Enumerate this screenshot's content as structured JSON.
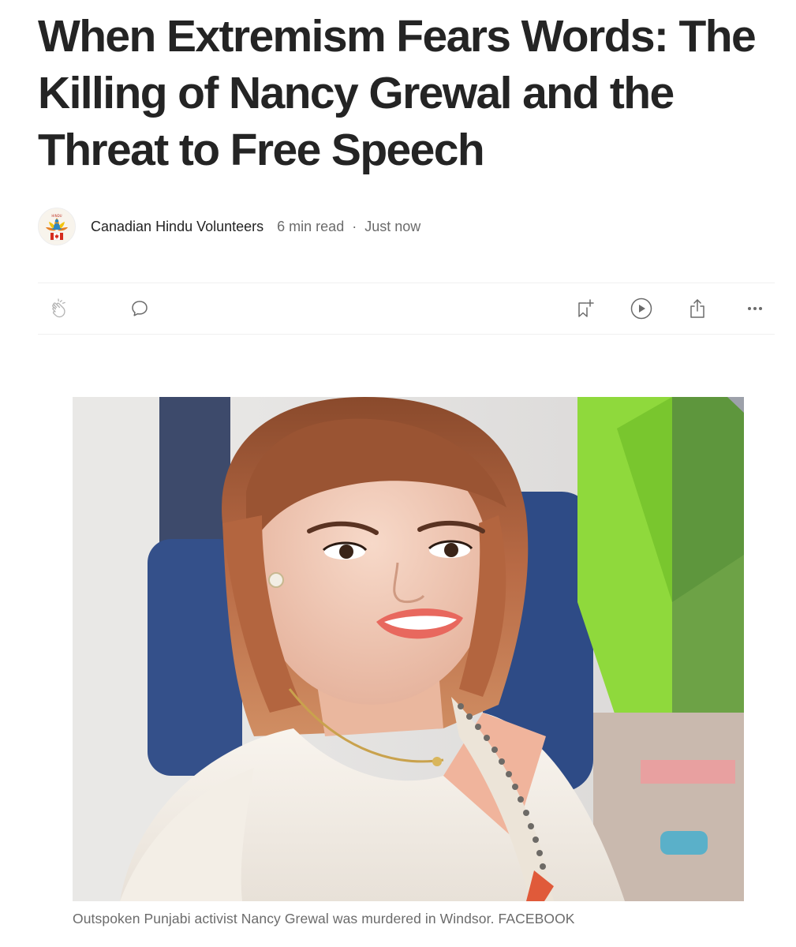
{
  "article": {
    "title_lines": [
      "When Extremism Fears Words: The",
      "Killing of Nancy Grewal and the",
      "Threat to Free Speech"
    ],
    "author": "Canadian Hindu Volunteers",
    "read_time": "6 min read",
    "separator": "·",
    "published": "Just now"
  },
  "avatar": {
    "icon": "hindu-volunteers-logo",
    "logo_text": "HINDU"
  },
  "actions": {
    "clap_icon": "clap-icon",
    "comment_icon": "comment-icon",
    "save_icon": "bookmark-add-icon",
    "listen_icon": "play-circle-icon",
    "share_icon": "share-icon",
    "more_icon": "more-icon"
  },
  "image": {
    "caption": "Outspoken Punjabi activist Nancy Grewal was murdered in Windsor. FACEBOOK"
  },
  "colors": {
    "text_primary": "#242424",
    "text_secondary": "#6b6b6b",
    "icon": "#6b6b6b",
    "divider": "#f0f0f0"
  }
}
